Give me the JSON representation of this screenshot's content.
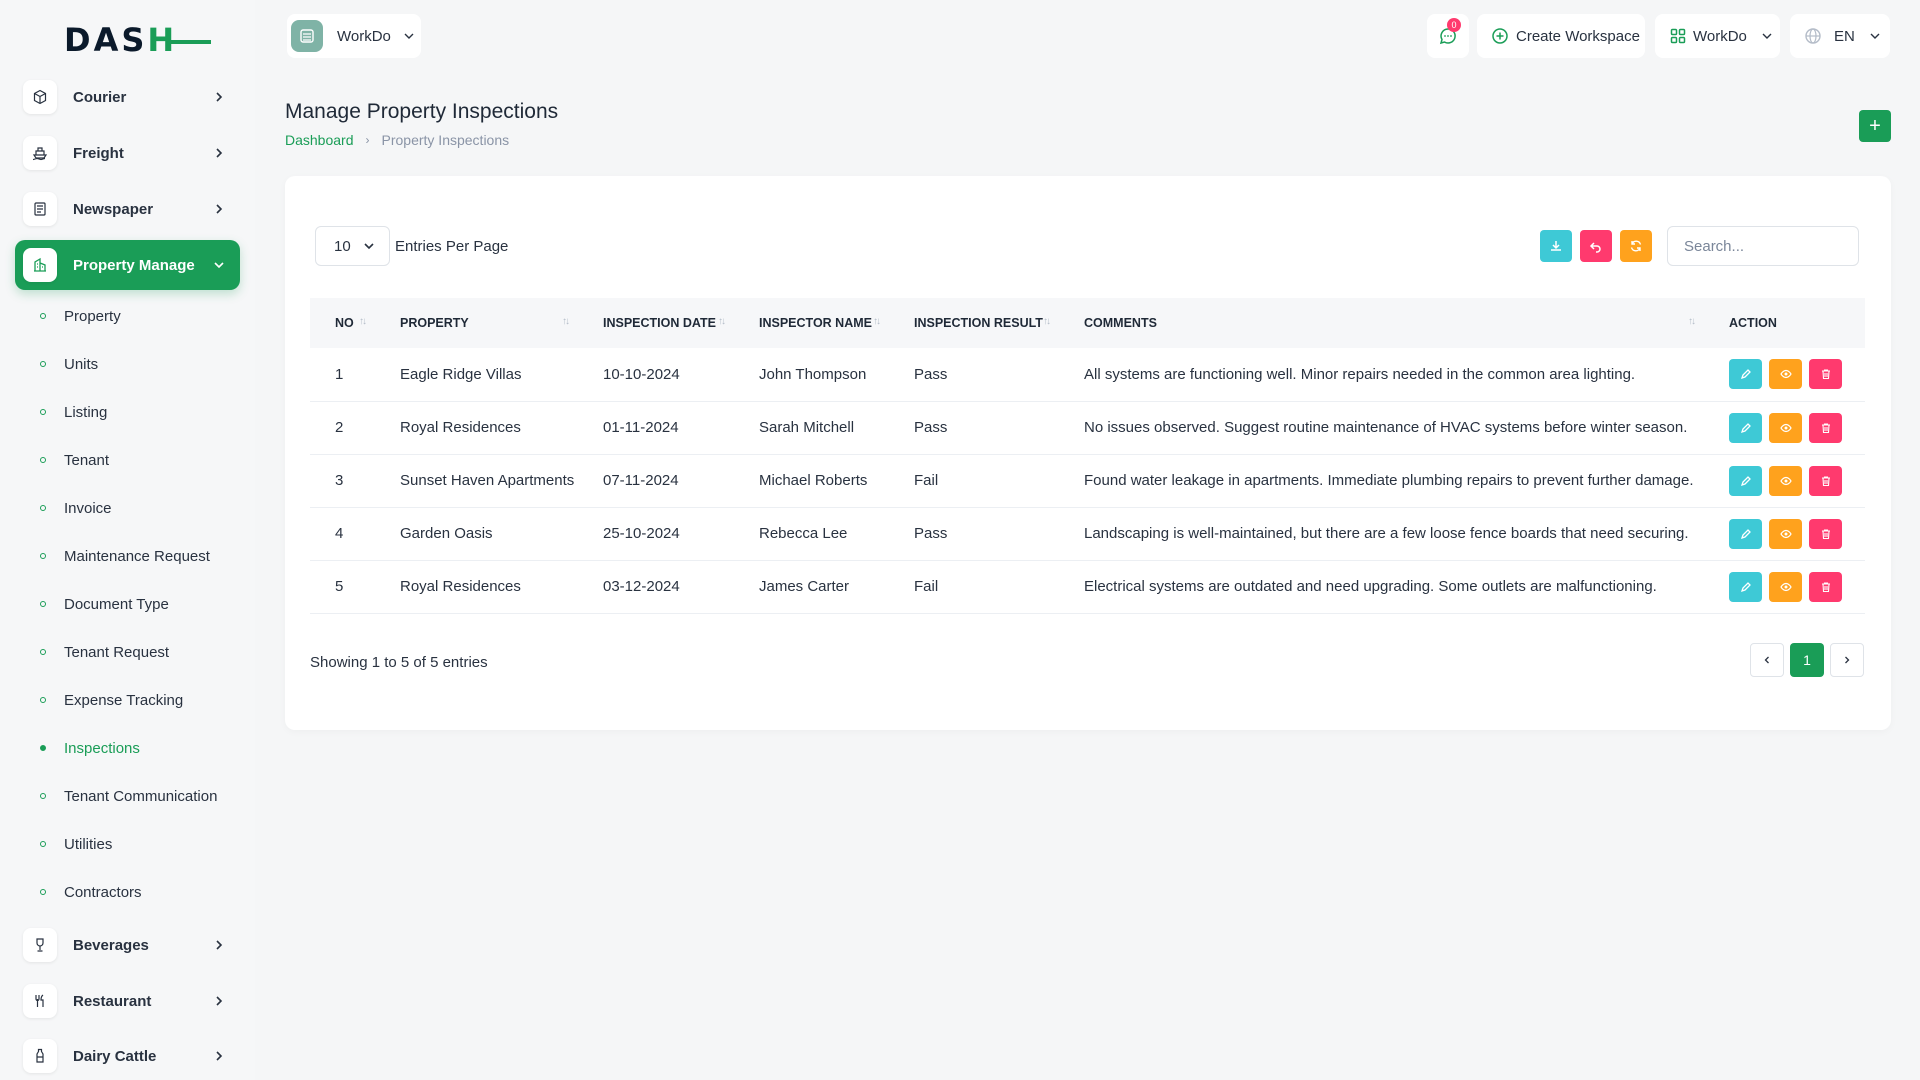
{
  "logo": {
    "text_main": "DAS",
    "text_accent": "H"
  },
  "sidebar": {
    "top_items": [
      {
        "label": "Courier",
        "icon": "box-icon"
      },
      {
        "label": "Freight",
        "icon": "ship-icon"
      },
      {
        "label": "Newspaper",
        "icon": "newspaper-icon"
      },
      {
        "label": "Property Manage",
        "icon": "building-icon"
      }
    ],
    "sub_items": [
      {
        "label": "Property"
      },
      {
        "label": "Units"
      },
      {
        "label": "Listing"
      },
      {
        "label": "Tenant"
      },
      {
        "label": "Invoice"
      },
      {
        "label": "Maintenance Request"
      },
      {
        "label": "Document Type"
      },
      {
        "label": "Tenant Request"
      },
      {
        "label": "Expense Tracking"
      },
      {
        "label": "Inspections"
      },
      {
        "label": "Tenant Communication"
      },
      {
        "label": "Utilities"
      },
      {
        "label": "Contractors"
      }
    ],
    "bottom_items": [
      {
        "label": "Beverages",
        "icon": "wine-icon"
      },
      {
        "label": "Restaurant",
        "icon": "utensils-icon"
      },
      {
        "label": "Dairy Cattle",
        "icon": "bottle-icon"
      }
    ]
  },
  "topbar": {
    "workspace_label": "WorkDo",
    "notification_count": "0",
    "create_workspace_label": "Create Workspace",
    "user_workspace_label": "WorkDo",
    "language_label": "EN"
  },
  "page": {
    "title": "Manage Property Inspections",
    "breadcrumb_home": "Dashboard",
    "breadcrumb_current": "Property Inspections",
    "add_label": "+"
  },
  "table_controls": {
    "per_page_value": "10",
    "per_page_label": "Entries Per Page",
    "search_placeholder": "Search..."
  },
  "table": {
    "headers": [
      "NO",
      "PROPERTY",
      "INSPECTION DATE",
      "INSPECTOR NAME",
      "INSPECTION RESULT",
      "COMMENTS",
      "ACTION"
    ],
    "rows": [
      [
        "1",
        "Eagle Ridge Villas",
        "10-10-2024",
        "John Thompson",
        "Pass",
        "All systems are functioning well. Minor repairs needed in the common area lighting."
      ],
      [
        "2",
        "Royal Residences",
        "01-11-2024",
        "Sarah Mitchell",
        "Pass",
        "No issues observed. Suggest routine maintenance of HVAC systems before winter season."
      ],
      [
        "3",
        "Sunset Haven Apartments",
        "07-11-2024",
        "Michael Roberts",
        "Fail",
        "Found water leakage in apartments. Immediate plumbing repairs to prevent further damage."
      ],
      [
        "4",
        "Garden Oasis",
        "25-10-2024",
        "Rebecca Lee",
        "Pass",
        "Landscaping is well-maintained, but there are a few loose fence boards that need securing."
      ],
      [
        "5",
        "Royal Residences",
        "03-12-2024",
        "James Carter",
        "Fail",
        "Electrical systems are outdated and need upgrading. Some outlets are malfunctioning."
      ]
    ]
  },
  "pagination": {
    "showing_text": "Showing 1 to 5 of 5 entries",
    "current_page": "1"
  },
  "colors": {
    "primary": "#1a9d57",
    "info": "#3ec9d6",
    "warning": "#ffa21d",
    "danger": "#ff3a6e"
  }
}
